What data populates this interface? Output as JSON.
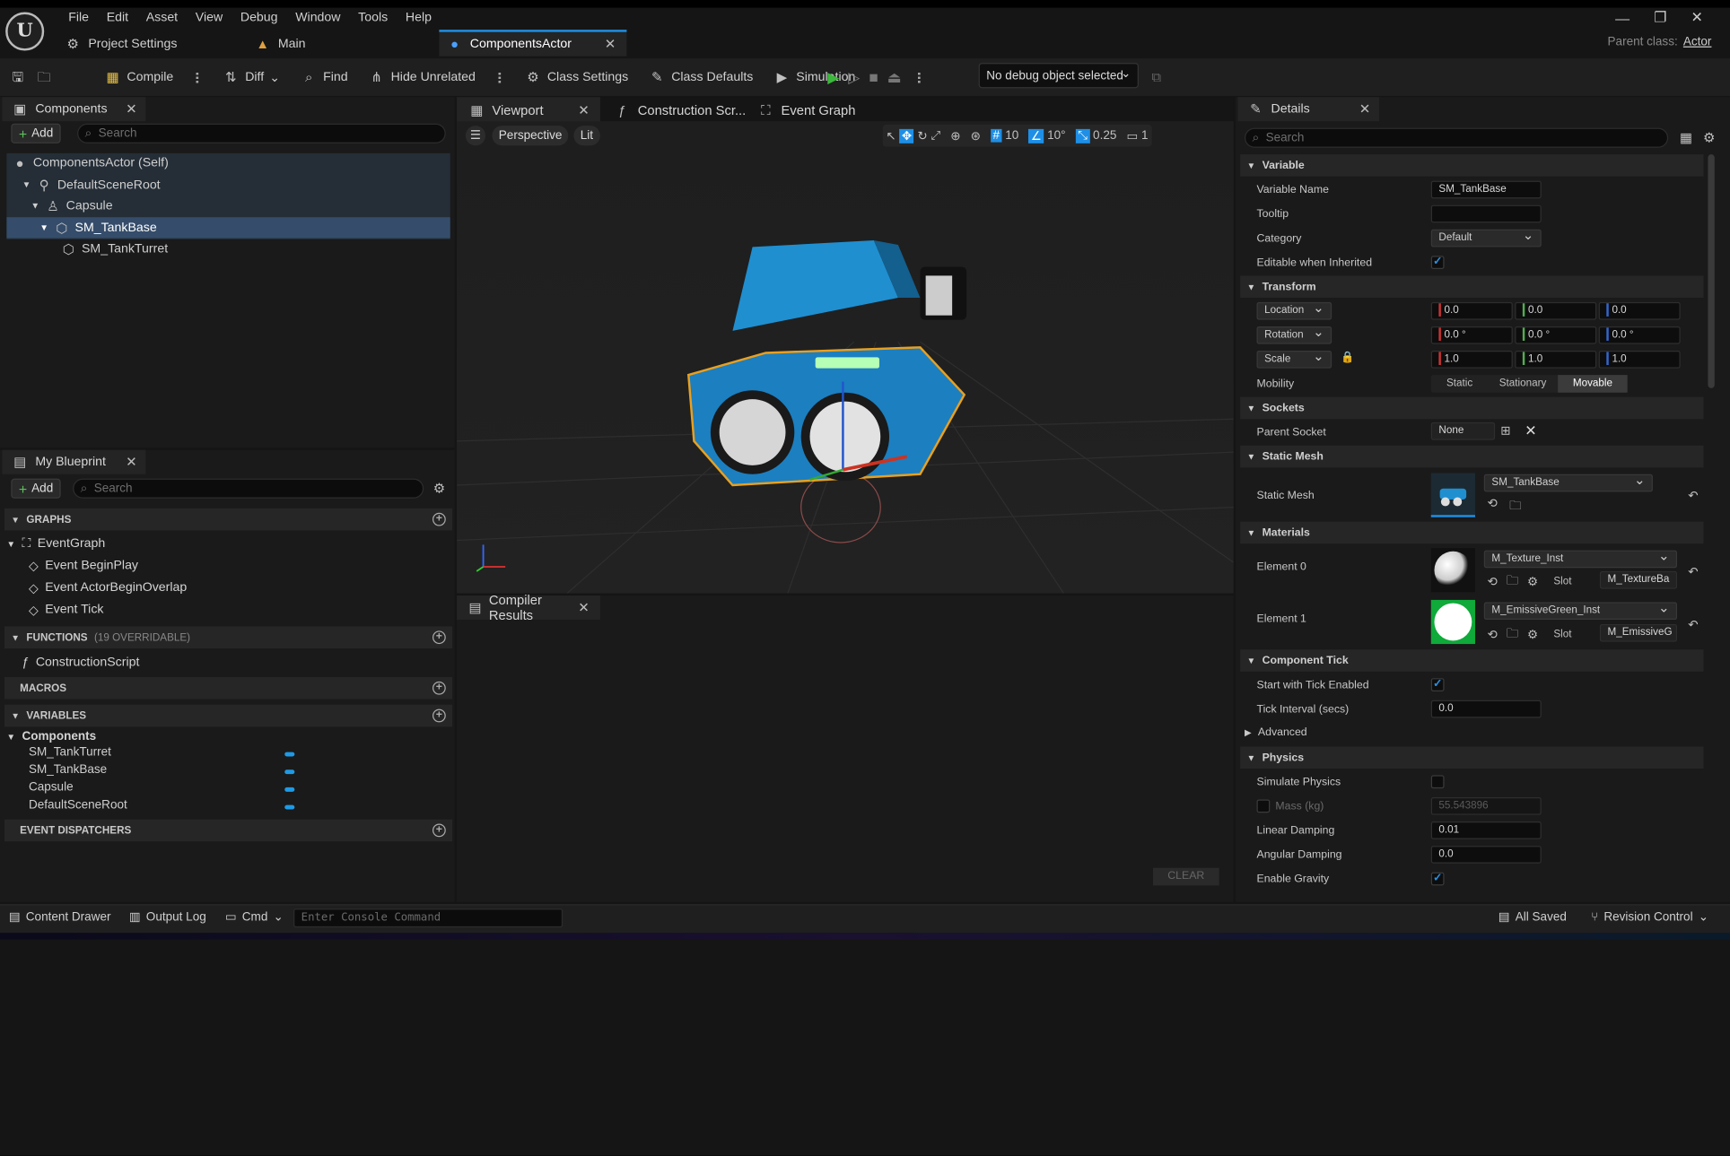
{
  "menu": [
    "File",
    "Edit",
    "Asset",
    "View",
    "Debug",
    "Window",
    "Tools",
    "Help"
  ],
  "doc_tabs": [
    {
      "label": "Project Settings",
      "icon": "settings-icon"
    },
    {
      "label": "Main",
      "icon": "map-icon"
    },
    {
      "label": "ComponentsActor",
      "icon": "blueprint-icon"
    }
  ],
  "parent_class": {
    "label": "Parent class:",
    "value": "Actor"
  },
  "toolbar": {
    "compile": "Compile",
    "diff": "Diff",
    "find": "Find",
    "hide_unrelated": "Hide Unrelated",
    "class_settings": "Class Settings",
    "class_defaults": "Class Defaults",
    "simulation": "Simulation",
    "debug_object": "No debug object selected"
  },
  "components_panel": {
    "tab": "Components",
    "add": "Add",
    "search_placeholder": "Search",
    "tree": [
      {
        "label": "ComponentsActor (Self)",
        "depth": 0
      },
      {
        "label": "DefaultSceneRoot",
        "depth": 1
      },
      {
        "label": "Capsule",
        "depth": 2
      },
      {
        "label": "SM_TankBase",
        "depth": 3,
        "selected": true
      },
      {
        "label": "SM_TankTurret",
        "depth": 4
      }
    ]
  },
  "my_blueprint": {
    "tab": "My Blueprint",
    "add": "Add",
    "search_placeholder": "Search",
    "graphs": "GRAPHS",
    "event_graph": "EventGraph",
    "events": [
      "Event BeginPlay",
      "Event ActorBeginOverlap",
      "Event Tick"
    ],
    "functions": "FUNCTIONS",
    "functions_count": "(19 OVERRIDABLE)",
    "construction_script": "ConstructionScript",
    "macros": "MACROS",
    "variables": "VARIABLES",
    "components_cat": "Components",
    "component_vars": [
      "SM_TankTurret",
      "SM_TankBase",
      "Capsule",
      "DefaultSceneRoot"
    ],
    "event_dispatchers": "EVENT DISPATCHERS"
  },
  "viewport": {
    "tabs": [
      "Viewport",
      "Construction Scr...",
      "Event Graph"
    ],
    "perspective": "Perspective",
    "lit": "Lit",
    "grid_snap": "10",
    "rot_snap": "10°",
    "scale_snap": "0.25",
    "cam_speed": "1"
  },
  "compiler": {
    "tab": "Compiler Results",
    "clear": "CLEAR"
  },
  "details": {
    "tab": "Details",
    "search_placeholder": "Search",
    "sections": {
      "variable": "Variable",
      "transform": "Transform",
      "sockets": "Sockets",
      "static_mesh": "Static Mesh",
      "materials": "Materials",
      "component_tick": "Component Tick",
      "physics": "Physics"
    },
    "variable_name_label": "Variable Name",
    "variable_name": "SM_TankBase",
    "tooltip_label": "Tooltip",
    "tooltip": "",
    "category_label": "Category",
    "category": "Default",
    "editable_label": "Editable when Inherited",
    "location": "Location",
    "rotation": "Rotation",
    "scale": "Scale",
    "loc": [
      "0.0",
      "0.0",
      "0.0"
    ],
    "rot": [
      "0.0 °",
      "0.0 °",
      "0.0 °"
    ],
    "scl": [
      "1.0",
      "1.0",
      "1.0"
    ],
    "mobility_label": "Mobility",
    "mobility": [
      "Static",
      "Stationary",
      "Movable"
    ],
    "parent_socket_label": "Parent Socket",
    "parent_socket": "None",
    "static_mesh_label": "Static Mesh",
    "static_mesh": "SM_TankBase",
    "element0_label": "Element 0",
    "element0": "M_Texture_Inst",
    "slot0": "M_TextureBa",
    "element1_label": "Element 1",
    "element1": "M_EmissiveGreen_Inst",
    "slot1": "M_EmissiveG",
    "slot_label": "Slot",
    "start_tick_label": "Start with Tick Enabled",
    "tick_interval_label": "Tick Interval (secs)",
    "tick_interval": "0.0",
    "advanced": "Advanced",
    "simulate_physics": "Simulate Physics",
    "mass_label": "Mass (kg)",
    "mass": "55.543896",
    "linear_damping_label": "Linear Damping",
    "linear_damping": "0.01",
    "angular_damping_label": "Angular Damping",
    "angular_damping": "0.0",
    "enable_gravity": "Enable Gravity"
  },
  "statusbar": {
    "content_drawer": "Content Drawer",
    "output_log": "Output Log",
    "cmd": "Cmd",
    "console_placeholder": "Enter Console Command",
    "saved": "All Saved",
    "revision": "Revision Control"
  },
  "colors": {
    "accent": "#1e8fe6",
    "selection": "#354d6b",
    "play": "#3cb83c",
    "bg": "#151515"
  }
}
